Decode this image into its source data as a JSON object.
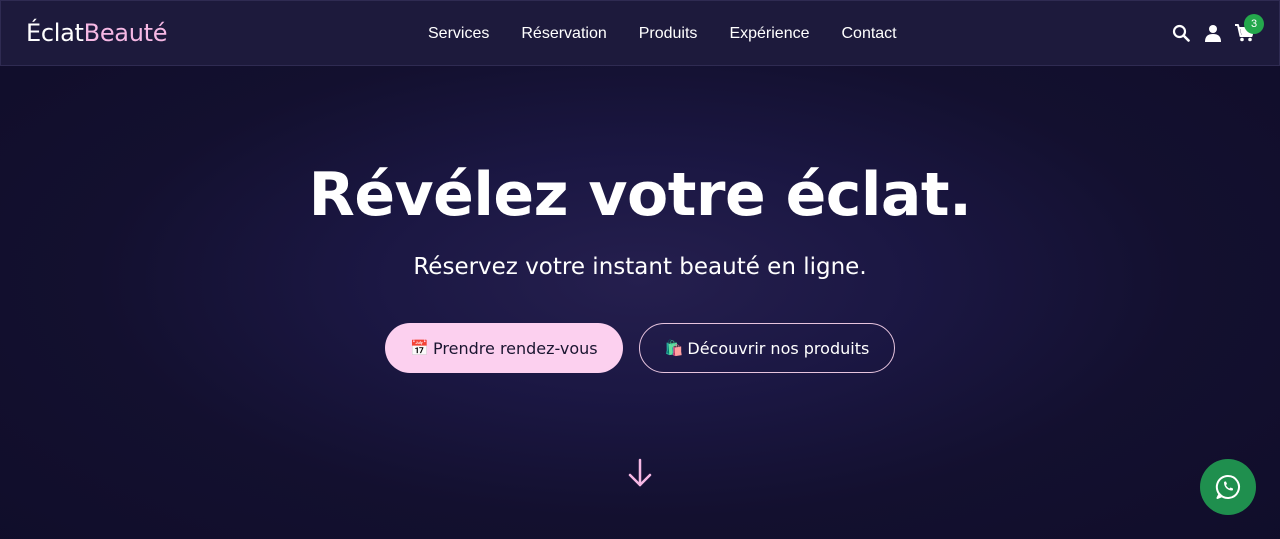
{
  "brand": {
    "part1": "Éclat",
    "part2": "Beauté"
  },
  "nav": {
    "items": [
      "Services",
      "Réservation",
      "Produits",
      "Expérience",
      "Contact"
    ]
  },
  "header_icons": {
    "search": "search-icon",
    "account": "user-icon",
    "cart": "cart-icon",
    "cart_count": "3"
  },
  "hero": {
    "title": "Révélez votre éclat.",
    "subtitle": "Réservez votre instant beauté en ligne.",
    "primary_button": {
      "icon": "📅",
      "label": "Prendre rendez-vous"
    },
    "secondary_button": {
      "icon": "🛍️",
      "label": "Découvrir nos produits"
    }
  },
  "colors": {
    "accent": "#f6b8e4",
    "primary_button_bg": "#fcd0ef",
    "badge": "#24a84c",
    "whatsapp": "#1f8f4e"
  }
}
